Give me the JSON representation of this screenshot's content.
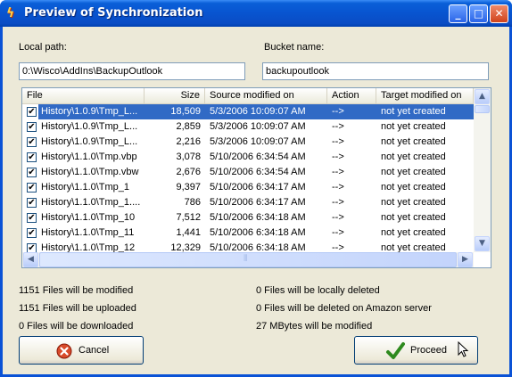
{
  "window": {
    "title": "Preview of Synchronization",
    "icon": "lightning-icon",
    "controls": {
      "minimize": "_",
      "maximize": "□",
      "close": "✕"
    }
  },
  "local_path": {
    "label": "Local path:",
    "value": "0:\\Wisco\\AddIns\\BackupOutlook"
  },
  "bucket": {
    "label": "Bucket name:",
    "value": "backupoutlook"
  },
  "table": {
    "columns": [
      "File",
      "Size",
      "Source modified on",
      "Action",
      "Target modified on"
    ],
    "rows": [
      {
        "file": "History\\1.0.9\\Tmp_L...",
        "size": "18,509",
        "src": "5/3/2006 10:09:07 AM",
        "action": "-->",
        "target": "not yet created",
        "checked": true,
        "selected": true
      },
      {
        "file": "History\\1.0.9\\Tmp_L...",
        "size": "2,859",
        "src": "5/3/2006 10:09:07 AM",
        "action": "-->",
        "target": "not yet created",
        "checked": true,
        "selected": false
      },
      {
        "file": "History\\1.0.9\\Tmp_L...",
        "size": "2,216",
        "src": "5/3/2006 10:09:07 AM",
        "action": "-->",
        "target": "not yet created",
        "checked": true,
        "selected": false
      },
      {
        "file": "History\\1.1.0\\Tmp.vbp",
        "size": "3,078",
        "src": "5/10/2006 6:34:54 AM",
        "action": "-->",
        "target": "not yet created",
        "checked": true,
        "selected": false
      },
      {
        "file": "History\\1.1.0\\Tmp.vbw",
        "size": "2,676",
        "src": "5/10/2006 6:34:54 AM",
        "action": "-->",
        "target": "not yet created",
        "checked": true,
        "selected": false
      },
      {
        "file": "History\\1.1.0\\Tmp_1",
        "size": "9,397",
        "src": "5/10/2006 6:34:17 AM",
        "action": "-->",
        "target": "not yet created",
        "checked": true,
        "selected": false
      },
      {
        "file": "History\\1.1.0\\Tmp_1....",
        "size": "786",
        "src": "5/10/2006 6:34:17 AM",
        "action": "-->",
        "target": "not yet created",
        "checked": true,
        "selected": false
      },
      {
        "file": "History\\1.1.0\\Tmp_10",
        "size": "7,512",
        "src": "5/10/2006 6:34:18 AM",
        "action": "-->",
        "target": "not yet created",
        "checked": true,
        "selected": false
      },
      {
        "file": "History\\1.1.0\\Tmp_11",
        "size": "1,441",
        "src": "5/10/2006 6:34:18 AM",
        "action": "-->",
        "target": "not yet created",
        "checked": true,
        "selected": false
      },
      {
        "file": "History\\1.1.0\\Tmp_12",
        "size": "12,329",
        "src": "5/10/2006 6:34:18 AM",
        "action": "-->",
        "target": "not yet created",
        "checked": true,
        "selected": false
      }
    ]
  },
  "summary": {
    "modified": "1151 Files will be modified",
    "uploaded": "1151 Files will be uploaded",
    "downloaded": "0 Files will be downloaded",
    "locally_deleted": "0 Files will be locally deleted",
    "amazon_deleted": "0 Files will be deleted on Amazon server",
    "mbytes": "27 MBytes will be modified"
  },
  "buttons": {
    "cancel": "Cancel",
    "proceed": "Proceed"
  },
  "colors": {
    "title_bar": "#0854d0",
    "selection": "#316ac5",
    "face": "#ece9d8"
  }
}
